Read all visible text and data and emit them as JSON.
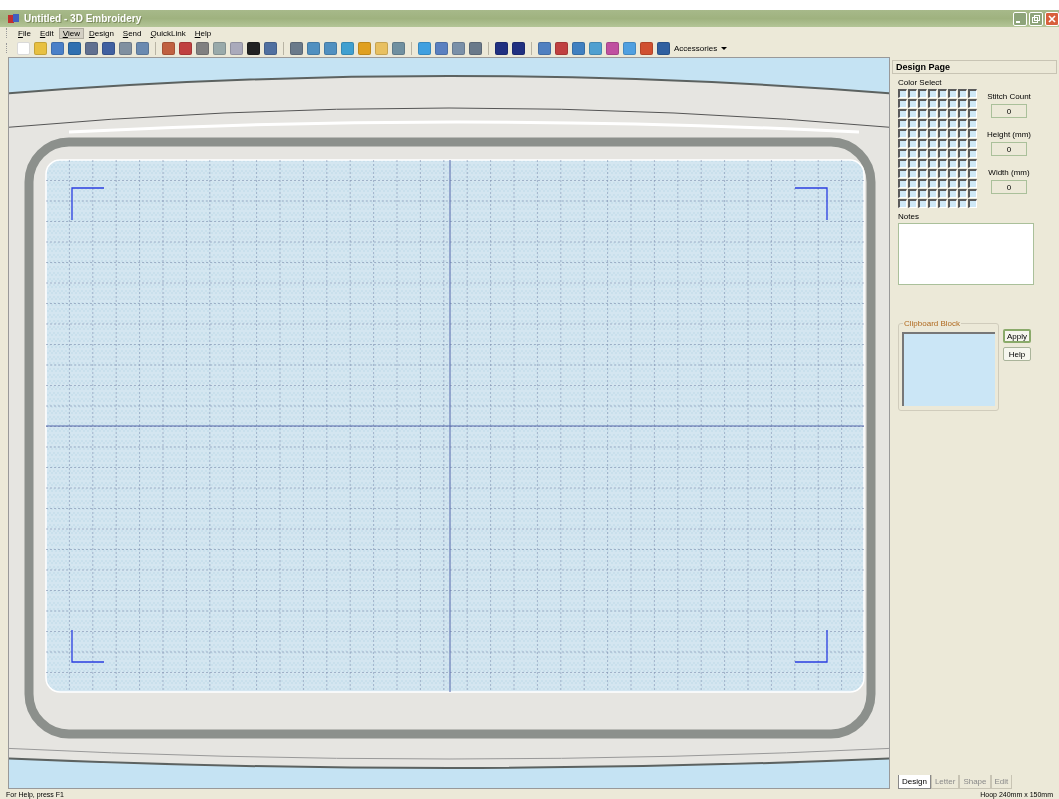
{
  "window": {
    "title": "Untitled - 3D Embroidery"
  },
  "menu": [
    {
      "label": "File",
      "selected": false
    },
    {
      "label": "Edit",
      "selected": false
    },
    {
      "label": "View",
      "selected": true
    },
    {
      "label": "Design",
      "selected": false
    },
    {
      "label": "Send",
      "selected": false
    },
    {
      "label": "QuickLink",
      "selected": false
    },
    {
      "label": "Help",
      "selected": false
    }
  ],
  "toolbar": {
    "accessories": "Accessories"
  },
  "panel": {
    "title": "Design Page",
    "color_select": "Color Select",
    "fields": [
      {
        "label": "Stitch Count",
        "value": "0"
      },
      {
        "label": "Height (mm)",
        "value": "0"
      },
      {
        "label": "Width (mm)",
        "value": "0"
      }
    ],
    "notes_label": "Notes",
    "clipboard": {
      "legend": "Clipboard Block",
      "buttons": [
        {
          "label": "Apply",
          "selected": true
        },
        {
          "label": "Help",
          "selected": false
        }
      ]
    }
  },
  "tabs": [
    {
      "label": "Design",
      "selected": true
    },
    {
      "label": "Letter",
      "selected": false
    },
    {
      "label": "Shape",
      "selected": false
    },
    {
      "label": "Edit",
      "selected": false
    }
  ],
  "status_bar": {
    "left": "For Help, press F1",
    "right": "Hoop  240mm x 150mm"
  }
}
